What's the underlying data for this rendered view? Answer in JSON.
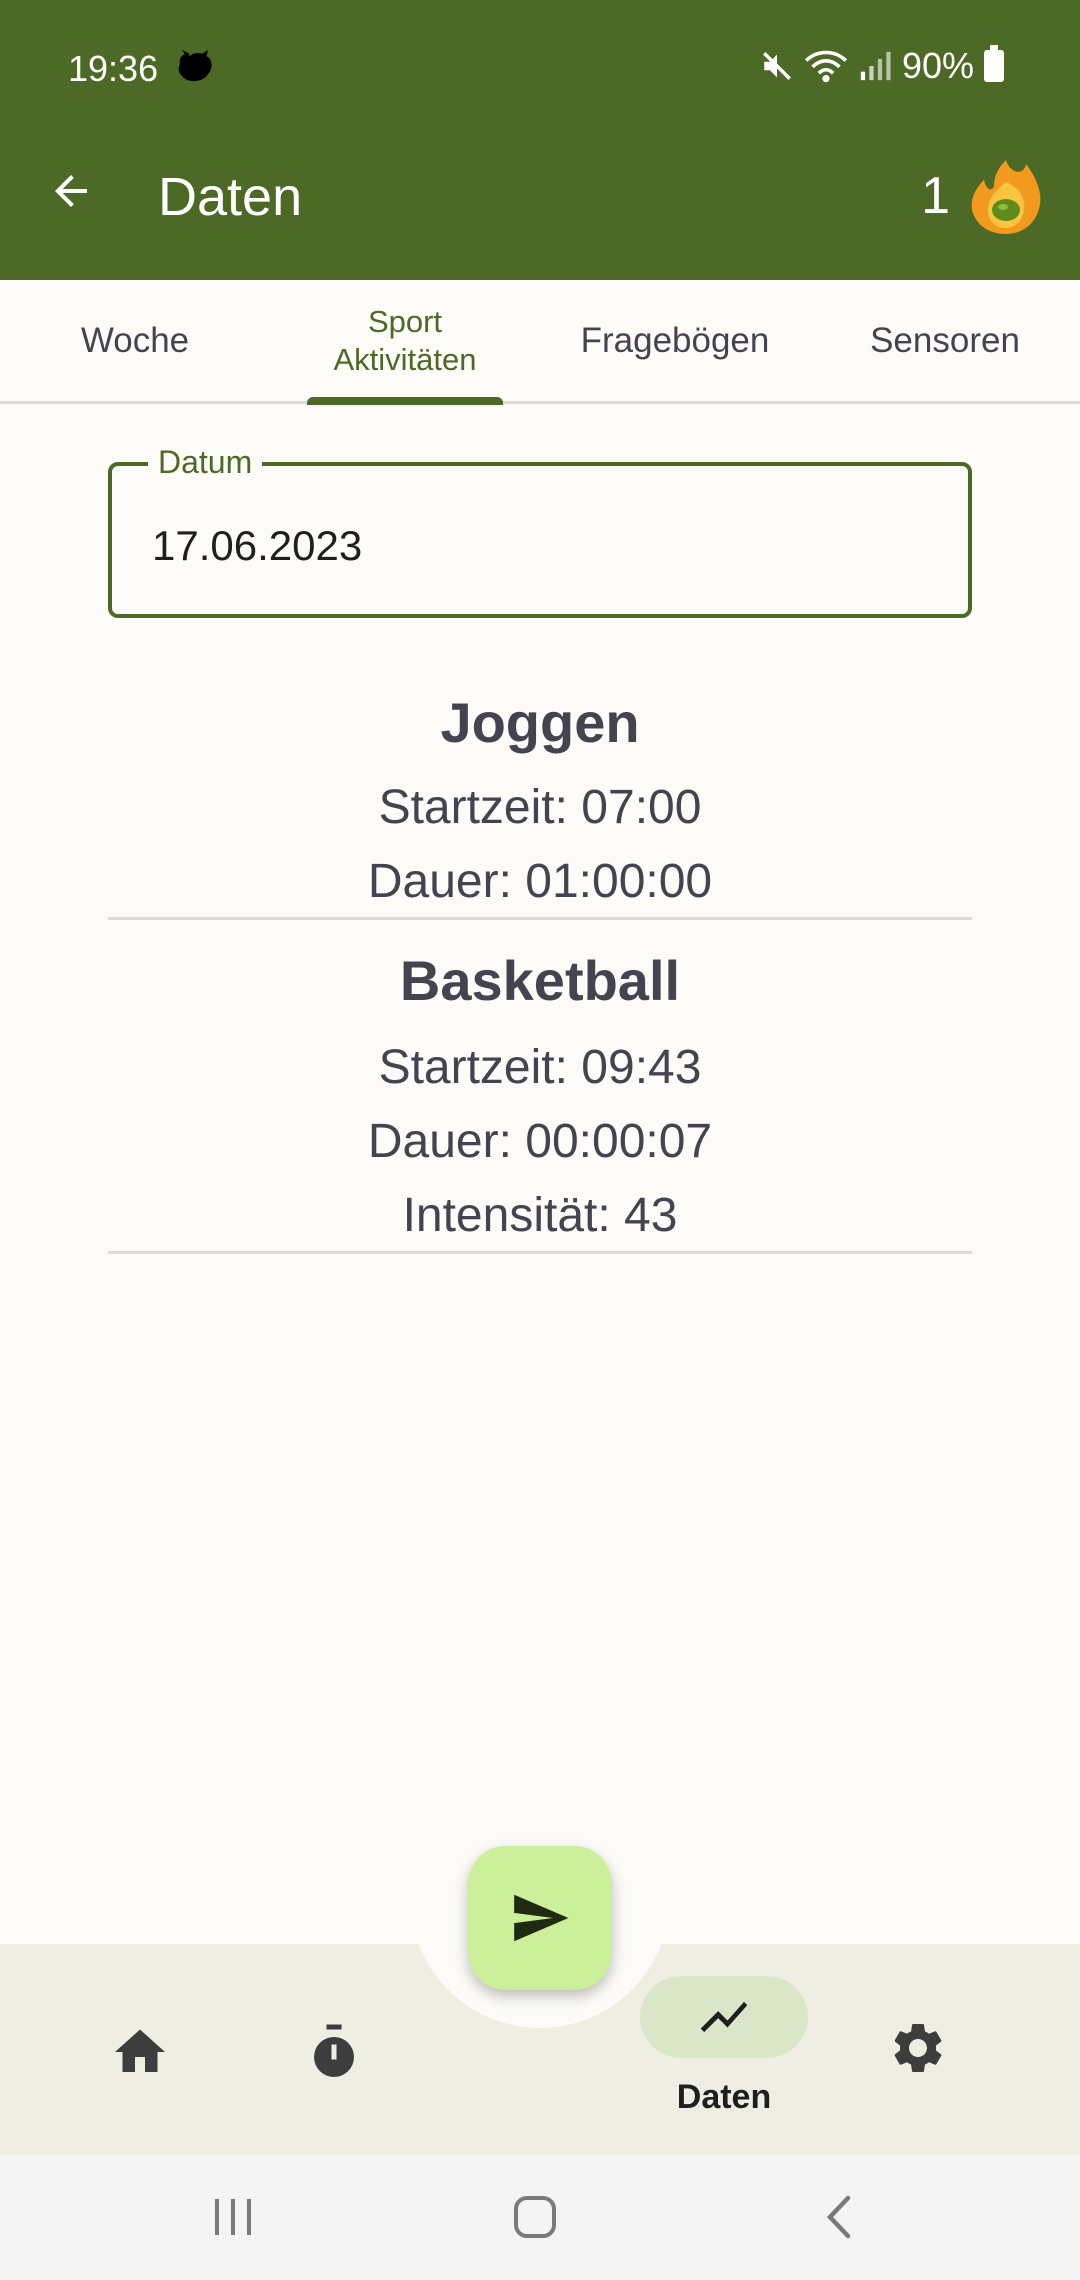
{
  "status_bar": {
    "time": "19:36",
    "battery": "90%"
  },
  "app_bar": {
    "title": "Daten",
    "streak_count": "1"
  },
  "tabs": [
    {
      "label": "Woche",
      "active": false
    },
    {
      "label": "Sport\nAktivitäten",
      "active": true
    },
    {
      "label": "Fragebögen",
      "active": false
    },
    {
      "label": "Sensoren",
      "active": false
    }
  ],
  "date_field": {
    "label": "Datum",
    "value": "17.06.2023"
  },
  "activities": [
    {
      "title": "Joggen",
      "lines": [
        "Startzeit: 07:00",
        "Dauer: 01:00:00"
      ]
    },
    {
      "title": "Basketball",
      "lines": [
        "Startzeit: 09:43",
        "Dauer: 00:00:07",
        "Intensität: 43"
      ]
    }
  ],
  "bottom_nav": {
    "items": [
      {
        "icon": "home-icon"
      },
      {
        "icon": "timer-icon"
      },
      {
        "icon": "chart-line-icon",
        "label": "Daten",
        "active": true
      },
      {
        "icon": "gear-icon"
      }
    ],
    "fab_icon": "send-icon"
  },
  "colors": {
    "primary": "#4c6a26",
    "background": "#fcfbf7",
    "fab": "#ccf09a",
    "nav_background": "#eeeee2",
    "active_pill": "#dbe6c8",
    "text": "#45434f"
  }
}
